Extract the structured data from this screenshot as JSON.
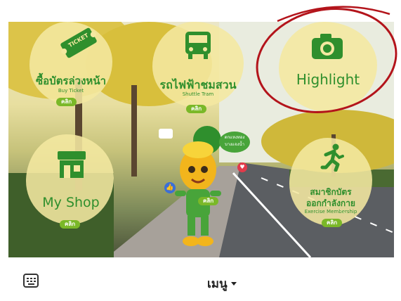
{
  "tiles": {
    "buy_ticket": {
      "title": "ซื้อบัตรล่วงหน้า",
      "subtitle": "Buy Ticket",
      "badge": "TICKET",
      "button": "คลิก"
    },
    "shuttle_tram": {
      "title": "รถไฟฟ้าชมสวน",
      "subtitle": "Shuttle Tram",
      "button": "คลิก"
    },
    "highlight": {
      "title": "Highlight"
    },
    "my_shop": {
      "title": "My Shop",
      "button": "คลิก"
    },
    "exercise": {
      "title_line1": "สมาชิกบัตร",
      "title_line2": "ออกกำลังกาย",
      "subtitle": "Exercise Membership",
      "button": "คลิก"
    },
    "mascot": {
      "bubble": "ตกแหงทอง",
      "bubble2": "บางแจงน้ำ",
      "button": "คลิก"
    }
  },
  "bottom_bar": {
    "menu_label": "เมนู"
  },
  "colors": {
    "green": "#2f8f2d",
    "pill": "#7ab828",
    "circle_annotation": "#b3141b"
  }
}
